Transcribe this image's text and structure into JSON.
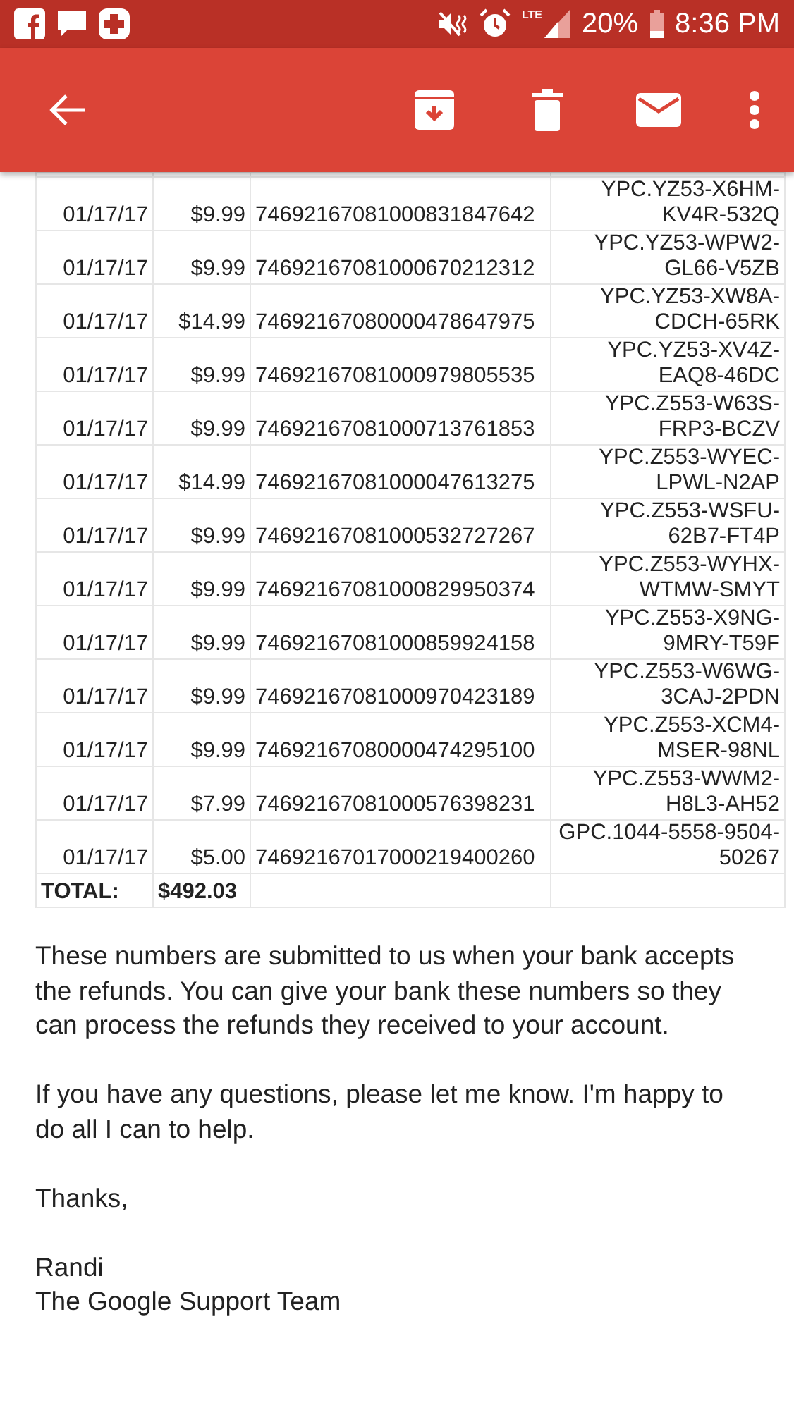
{
  "status_bar": {
    "battery": "20%",
    "time": "8:36 PM",
    "network": "LTE"
  },
  "rows": [
    {
      "date": "01/17/17",
      "amount": "$9.99",
      "number": "74692167081000831847642",
      "code": "YPC.YZ53-X6HM-KV4R-532Q"
    },
    {
      "date": "01/17/17",
      "amount": "$9.99",
      "number": "74692167081000670212312",
      "code": "YPC.YZ53-WPW2-GL66-V5ZB"
    },
    {
      "date": "01/17/17",
      "amount": "$14.99",
      "number": "74692167080000478647975",
      "code": "YPC.YZ53-XW8A-CDCH-65RK"
    },
    {
      "date": "01/17/17",
      "amount": "$9.99",
      "number": "74692167081000979805535",
      "code": "YPC.YZ53-XV4Z-EAQ8-46DC"
    },
    {
      "date": "01/17/17",
      "amount": "$9.99",
      "number": "74692167081000713761853",
      "code": "YPC.Z553-W63S-FRP3-BCZV"
    },
    {
      "date": "01/17/17",
      "amount": "$14.99",
      "number": "74692167081000047613275",
      "code": "YPC.Z553-WYEC-LPWL-N2AP"
    },
    {
      "date": "01/17/17",
      "amount": "$9.99",
      "number": "74692167081000532727267",
      "code": "YPC.Z553-WSFU-62B7-FT4P"
    },
    {
      "date": "01/17/17",
      "amount": "$9.99",
      "number": "74692167081000829950374",
      "code": "YPC.Z553-WYHX-WTMW-SMYT"
    },
    {
      "date": "01/17/17",
      "amount": "$9.99",
      "number": "74692167081000859924158",
      "code": "YPC.Z553-X9NG-9MRY-T59F"
    },
    {
      "date": "01/17/17",
      "amount": "$9.99",
      "number": "74692167081000970423189",
      "code": "YPC.Z553-W6WG-3CAJ-2PDN"
    },
    {
      "date": "01/17/17",
      "amount": "$9.99",
      "number": "74692167080000474295100",
      "code": "YPC.Z553-XCM4-MSER-98NL"
    },
    {
      "date": "01/17/17",
      "amount": "$7.99",
      "number": "74692167081000576398231",
      "code": "YPC.Z553-WWM2-H8L3-AH52"
    },
    {
      "date": "01/17/17",
      "amount": "$5.00",
      "number": "74692167017000219400260",
      "code": "GPC.1044-5558-9504-50267"
    }
  ],
  "total": {
    "label": "TOTAL:",
    "amount": "$492.03"
  },
  "paragraphs": [
    "These numbers are submitted to us when your bank accepts the refunds. You can give your bank these numbers so they can process the refunds they received to your account.",
    "If you have any questions, please let me know. I'm happy to do all I can to help.",
    "Thanks,"
  ],
  "signature": [
    "Randi",
    "The Google Support Team"
  ]
}
